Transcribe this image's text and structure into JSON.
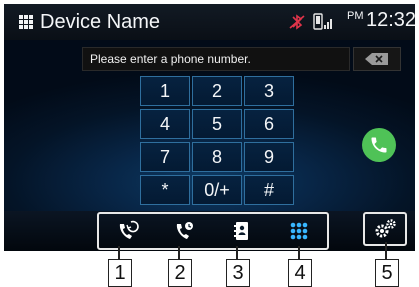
{
  "header": {
    "title": "Device Name",
    "ampm": "PM",
    "time": "12:32",
    "icons": [
      "grid-menu-icon",
      "bluetooth-muted-icon",
      "phone-signal-icon"
    ]
  },
  "dial": {
    "placeholder": "Please enter a phone number."
  },
  "keypad": {
    "keys": [
      "1",
      "2",
      "3",
      "4",
      "5",
      "6",
      "7",
      "8",
      "9",
      "*",
      "0/+",
      "#"
    ]
  },
  "functions": [
    {
      "name": "call-history",
      "icon": "call-history-icon"
    },
    {
      "name": "dial",
      "icon": "dial-icon"
    },
    {
      "name": "phonebook",
      "icon": "phonebook-icon"
    },
    {
      "name": "keypad",
      "icon": "keypad-icon",
      "active": true
    }
  ],
  "callouts": [
    "1",
    "2",
    "3",
    "4",
    "5"
  ],
  "colors": {
    "call_green": "#4fc257",
    "key_border": "#2f6f9e",
    "active_icon": "#38b6ff",
    "muted_red": "#d2233a"
  }
}
